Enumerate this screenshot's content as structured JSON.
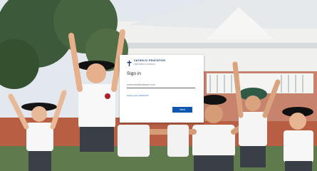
{
  "background": {
    "description_icon": "school-photo-students-jumping",
    "sky_color": "#e3e8ee",
    "building_color": "#b75e43",
    "roof_color": "#eef0f1"
  },
  "signin": {
    "brand_line1": "CATHOLIC EDUCATION",
    "brand_line2": "WESTERN AUSTRALIA",
    "title": "Sign in",
    "email_placeholder": "someone@example.com",
    "forgot_link": "Forgot your password?",
    "next_label": "Next",
    "accent_color": "#0f56b0"
  }
}
